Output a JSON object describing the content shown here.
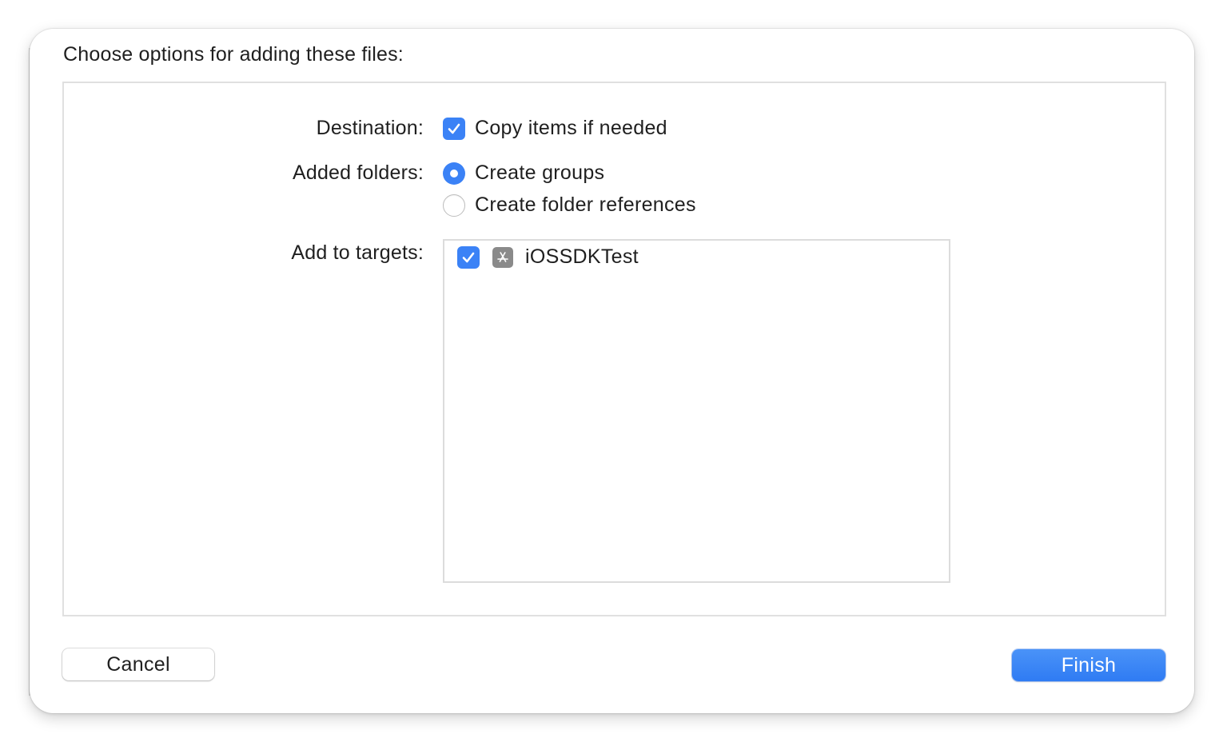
{
  "dialog": {
    "heading": "Choose options for adding these files:"
  },
  "destination": {
    "label": "Destination:",
    "copy_items": {
      "label": "Copy items if needed",
      "checked": true
    }
  },
  "added_folders": {
    "label": "Added folders:",
    "options": [
      {
        "label": "Create groups",
        "selected": true
      },
      {
        "label": "Create folder references",
        "selected": false
      }
    ]
  },
  "targets": {
    "label": "Add to targets:",
    "items": [
      {
        "name": "iOSSDKTest",
        "checked": true,
        "icon": "app-target-icon"
      }
    ]
  },
  "buttons": {
    "cancel": "Cancel",
    "finish": "Finish"
  },
  "colors": {
    "accent": "#3b82f6"
  }
}
